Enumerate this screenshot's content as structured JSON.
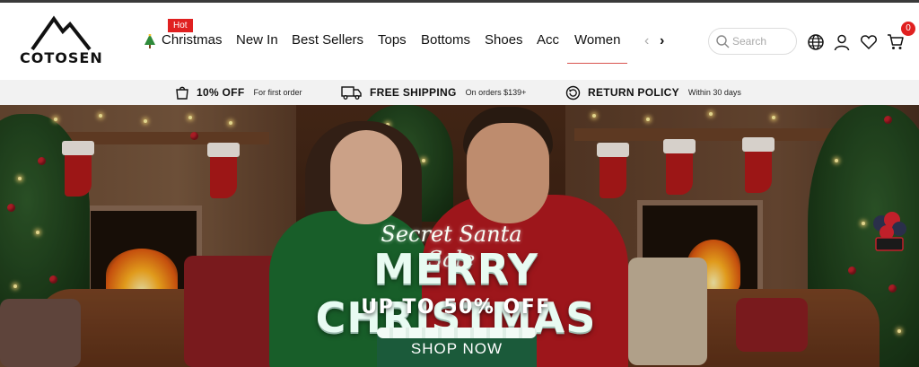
{
  "brand": {
    "logo_text": "COTOSEN"
  },
  "nav": {
    "items": [
      {
        "label": "Christmas",
        "badge": "Hot"
      },
      {
        "label": "New In"
      },
      {
        "label": "Best Sellers"
      },
      {
        "label": "Tops"
      },
      {
        "label": "Bottoms"
      },
      {
        "label": "Shoes"
      },
      {
        "label": "Acc"
      },
      {
        "label": "Women",
        "active": true
      }
    ],
    "prev_icon": "chevron-left-icon",
    "next_icon": "chevron-right-icon"
  },
  "search": {
    "placeholder": "Search"
  },
  "header_icons": [
    "globe-icon",
    "user-icon",
    "heart-icon",
    "cart-icon"
  ],
  "cart": {
    "count": "0"
  },
  "promo_bar": [
    {
      "icon": "bag-icon",
      "title": "10% OFF",
      "sub": "For first order"
    },
    {
      "icon": "truck-icon",
      "title": "FREE SHIPPING",
      "sub": "On orders $139+"
    },
    {
      "icon": "return-icon",
      "title": "RETURN POLICY",
      "sub": "Within 30 days"
    }
  ],
  "hero": {
    "script_title": "Secret Santa Sale",
    "headline": "MERRY CHRISTMAS",
    "offer": "UP TO 50% OFF",
    "cta": "SHOP NOW"
  },
  "colors": {
    "accent_red": "#e02020",
    "cta_green": "#1b5a3a",
    "promo_bg": "#f2f2f2"
  }
}
